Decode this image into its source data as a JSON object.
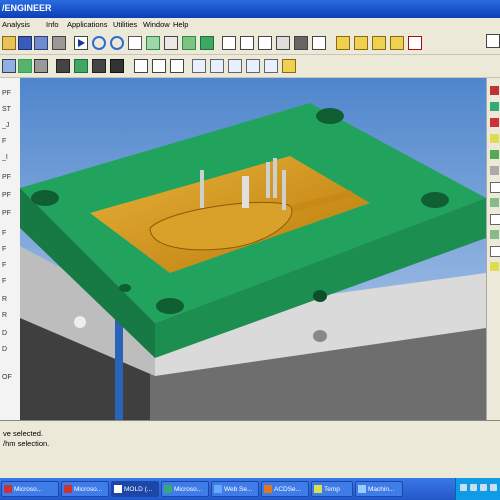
{
  "window": {
    "title": "/ENGINEER"
  },
  "menu": {
    "items": [
      "Analysis",
      "Info",
      "Applications",
      "Utilities",
      "Window",
      "Help"
    ]
  },
  "messages": {
    "line1": "ve selected.",
    "line2": "/hm selection."
  },
  "left_panel": {
    "fragments": [
      "PF",
      "ST",
      "_J",
      "F",
      "_I",
      "PF",
      "PF",
      "PF",
      "F",
      "F",
      "F",
      "F",
      "R",
      "R",
      "D",
      "D",
      "OF"
    ]
  },
  "taskbar": {
    "items": [
      {
        "label": "Microso...",
        "active": false
      },
      {
        "label": "Microso...",
        "active": false
      },
      {
        "label": "MOLD (...",
        "active": true
      },
      {
        "label": "Microso...",
        "active": false
      },
      {
        "label": "Web Se...",
        "active": false
      },
      {
        "label": "ACDSe...",
        "active": false
      },
      {
        "label": "Temp",
        "active": false
      },
      {
        "label": "Machin...",
        "active": false
      }
    ]
  },
  "colors": {
    "mold_green": "#1e9a55",
    "mold_gold": "#d79a1a",
    "steel_light": "#d8d8d8",
    "steel_dark": "#5d5d5d",
    "title_blue": "#0a3fb5",
    "viewport_bg": "#6f9ad6"
  },
  "icons": [
    "open-icon",
    "save-icon",
    "print-icon",
    "play-icon",
    "zoom-in-icon",
    "zoom-out-icon",
    "refit-icon",
    "orient-icon",
    "shade-icon",
    "datum-plane-icon",
    "datum-axis-icon",
    "datum-point-icon",
    "sketch-icon",
    "extrude-icon",
    "revolve-icon",
    "sweep-icon",
    "blend-icon",
    "curve-icon"
  ]
}
